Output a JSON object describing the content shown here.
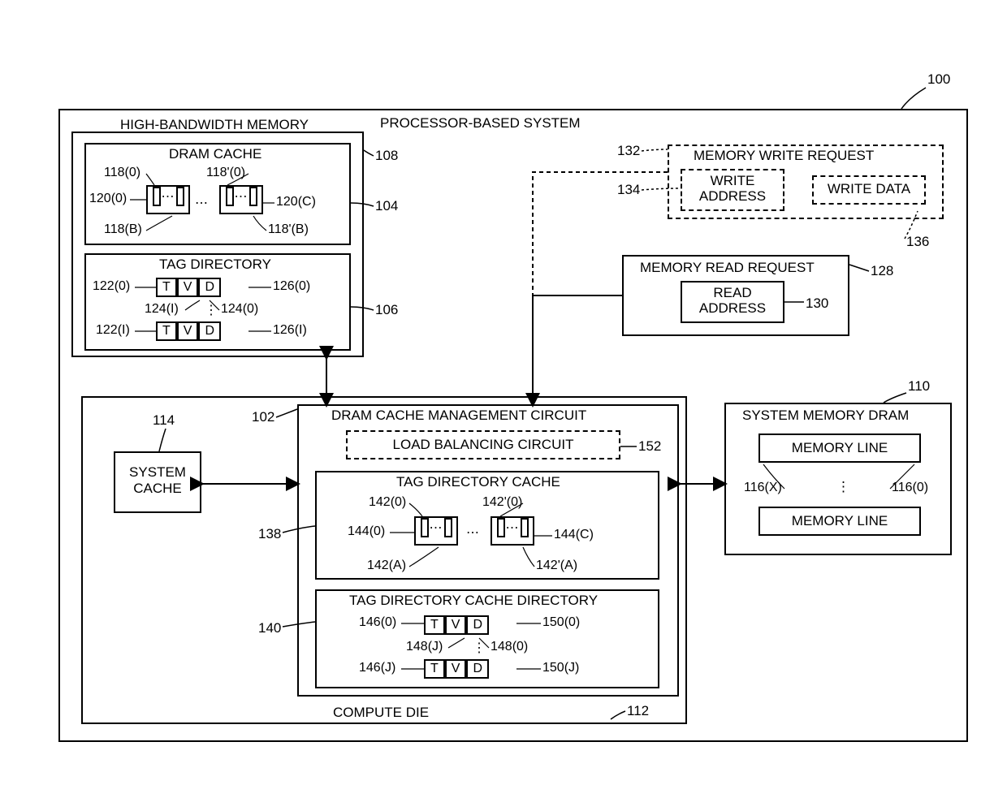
{
  "refs": {
    "system": "100",
    "hbm": "108",
    "dram_cache": "104",
    "tag_dir": "106",
    "sys_mem": "110",
    "compute_die": "112",
    "sys_cache": "114",
    "dcmc": "102",
    "tdc": "138",
    "tdcd": "140",
    "lbc": "152",
    "mrr": "128",
    "ra": "130",
    "mwr": "132",
    "wa": "134",
    "wd": "136"
  },
  "titles": {
    "system": "PROCESSOR-BASED SYSTEM",
    "hbm": "HIGH-BANDWIDTH MEMORY",
    "dram_cache": "DRAM CACHE",
    "tag_dir": "TAG DIRECTORY",
    "sys_mem": "SYSTEM MEMORY DRAM",
    "mem_line": "MEMORY LINE",
    "compute_die": "COMPUTE DIE",
    "sys_cache": "SYSTEM CACHE",
    "dcmc": "DRAM CACHE MANAGEMENT CIRCUIT",
    "lbc": "LOAD BALANCING CIRCUIT",
    "tdc": "TAG DIRECTORY CACHE",
    "tdcd": "TAG DIRECTORY CACHE DIRECTORY",
    "mrr": "MEMORY READ REQUEST",
    "ra": "READ ADDRESS",
    "mwr": "MEMORY WRITE REQUEST",
    "wa": "WRITE ADDRESS",
    "wd": "WRITE DATA"
  },
  "cache_labels": {
    "dc": {
      "tl": "118(0)",
      "tr": "118'(0)",
      "ml": "120(0)",
      "mr": "120(C)",
      "bl": "118(B)",
      "br": "118'(B)"
    },
    "td": {
      "tl": "122(0)",
      "tr": "126(0)",
      "bl": "122(I)",
      "br": "126(I)",
      "ml": "124(I)",
      "mr": "124(0)"
    },
    "sm": {
      "l": "116(X)",
      "r": "116(0)"
    },
    "tdc": {
      "tl": "142(0)",
      "tr": "142'(0)",
      "ml": "144(0)",
      "mr": "144(C)",
      "bl": "142(A)",
      "br": "142'(A)"
    },
    "tdcd": {
      "tl": "146(0)",
      "tr": "150(0)",
      "bl": "146(J)",
      "br": "150(J)",
      "ml": "148(J)",
      "mr": "148(0)"
    }
  },
  "tvd": {
    "t": "T",
    "v": "V",
    "d": "D"
  }
}
